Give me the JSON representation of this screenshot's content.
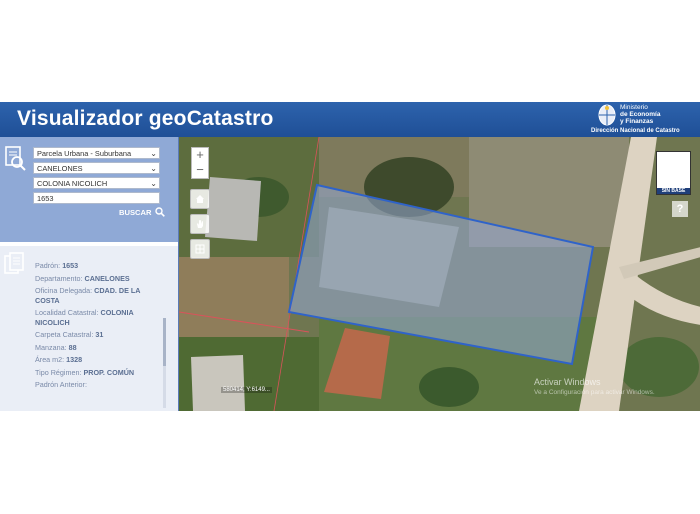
{
  "header": {
    "title": "Visualizador geoCatastro",
    "ministry_line1": "Ministerio",
    "ministry_line2": "de Economía",
    "ministry_line3": "y Finanzas",
    "agency": "Dirección Nacional de Catastro"
  },
  "search": {
    "tipo": "Parcela Urbana - Suburbana",
    "departamento": "CANELONES",
    "localidad": "COLONIA NICOLICH",
    "padron": "1653",
    "button_label": "BUSCAR"
  },
  "info": {
    "rows": [
      {
        "label": "Padrón:",
        "value": "1653"
      },
      {
        "label": "Departamento:",
        "value": "CANELONES"
      },
      {
        "label": "Oficina Delegada:",
        "value": "CDAD. DE LA COSTA"
      },
      {
        "label": "Localidad Catastral:",
        "value": "COLONIA NICOLICH"
      },
      {
        "label": "Carpeta Catastral:",
        "value": "31"
      },
      {
        "label": "Manzana:",
        "value": "88"
      },
      {
        "label": "Área m2:",
        "value": "1328"
      },
      {
        "label": "Tipo Régimen:",
        "value": "PROP. COMÚN"
      },
      {
        "label": "Padrón Anterior:",
        "value": ""
      }
    ]
  },
  "map": {
    "zoom_in": "+",
    "zoom_out": "−",
    "basemap_label": "SIN BASE",
    "help": "?",
    "coords": "580414, Y:6149...",
    "watermark_title": "Activar Windows",
    "watermark_text": "Ve a Configuración para activar Windows."
  },
  "colors": {
    "header_bg": "#2255a4",
    "search_panel": "#8fa9d6",
    "parcel_outline": "#2f63c9"
  }
}
